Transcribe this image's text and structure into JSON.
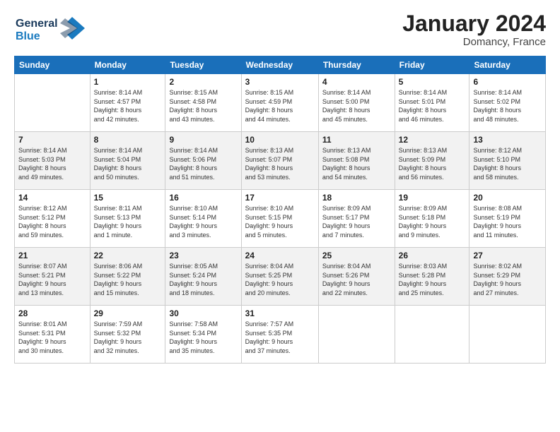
{
  "logo": {
    "line1": "General",
    "line2": "Blue"
  },
  "title": "January 2024",
  "subtitle": "Domancy, France",
  "headers": [
    "Sunday",
    "Monday",
    "Tuesday",
    "Wednesday",
    "Thursday",
    "Friday",
    "Saturday"
  ],
  "weeks": [
    [
      {
        "day": "",
        "info": ""
      },
      {
        "day": "1",
        "info": "Sunrise: 8:14 AM\nSunset: 4:57 PM\nDaylight: 8 hours\nand 42 minutes."
      },
      {
        "day": "2",
        "info": "Sunrise: 8:15 AM\nSunset: 4:58 PM\nDaylight: 8 hours\nand 43 minutes."
      },
      {
        "day": "3",
        "info": "Sunrise: 8:15 AM\nSunset: 4:59 PM\nDaylight: 8 hours\nand 44 minutes."
      },
      {
        "day": "4",
        "info": "Sunrise: 8:14 AM\nSunset: 5:00 PM\nDaylight: 8 hours\nand 45 minutes."
      },
      {
        "day": "5",
        "info": "Sunrise: 8:14 AM\nSunset: 5:01 PM\nDaylight: 8 hours\nand 46 minutes."
      },
      {
        "day": "6",
        "info": "Sunrise: 8:14 AM\nSunset: 5:02 PM\nDaylight: 8 hours\nand 48 minutes."
      }
    ],
    [
      {
        "day": "7",
        "info": "Sunrise: 8:14 AM\nSunset: 5:03 PM\nDaylight: 8 hours\nand 49 minutes."
      },
      {
        "day": "8",
        "info": "Sunrise: 8:14 AM\nSunset: 5:04 PM\nDaylight: 8 hours\nand 50 minutes."
      },
      {
        "day": "9",
        "info": "Sunrise: 8:14 AM\nSunset: 5:06 PM\nDaylight: 8 hours\nand 51 minutes."
      },
      {
        "day": "10",
        "info": "Sunrise: 8:13 AM\nSunset: 5:07 PM\nDaylight: 8 hours\nand 53 minutes."
      },
      {
        "day": "11",
        "info": "Sunrise: 8:13 AM\nSunset: 5:08 PM\nDaylight: 8 hours\nand 54 minutes."
      },
      {
        "day": "12",
        "info": "Sunrise: 8:13 AM\nSunset: 5:09 PM\nDaylight: 8 hours\nand 56 minutes."
      },
      {
        "day": "13",
        "info": "Sunrise: 8:12 AM\nSunset: 5:10 PM\nDaylight: 8 hours\nand 58 minutes."
      }
    ],
    [
      {
        "day": "14",
        "info": "Sunrise: 8:12 AM\nSunset: 5:12 PM\nDaylight: 8 hours\nand 59 minutes."
      },
      {
        "day": "15",
        "info": "Sunrise: 8:11 AM\nSunset: 5:13 PM\nDaylight: 9 hours\nand 1 minute."
      },
      {
        "day": "16",
        "info": "Sunrise: 8:10 AM\nSunset: 5:14 PM\nDaylight: 9 hours\nand 3 minutes."
      },
      {
        "day": "17",
        "info": "Sunrise: 8:10 AM\nSunset: 5:15 PM\nDaylight: 9 hours\nand 5 minutes."
      },
      {
        "day": "18",
        "info": "Sunrise: 8:09 AM\nSunset: 5:17 PM\nDaylight: 9 hours\nand 7 minutes."
      },
      {
        "day": "19",
        "info": "Sunrise: 8:09 AM\nSunset: 5:18 PM\nDaylight: 9 hours\nand 9 minutes."
      },
      {
        "day": "20",
        "info": "Sunrise: 8:08 AM\nSunset: 5:19 PM\nDaylight: 9 hours\nand 11 minutes."
      }
    ],
    [
      {
        "day": "21",
        "info": "Sunrise: 8:07 AM\nSunset: 5:21 PM\nDaylight: 9 hours\nand 13 minutes."
      },
      {
        "day": "22",
        "info": "Sunrise: 8:06 AM\nSunset: 5:22 PM\nDaylight: 9 hours\nand 15 minutes."
      },
      {
        "day": "23",
        "info": "Sunrise: 8:05 AM\nSunset: 5:24 PM\nDaylight: 9 hours\nand 18 minutes."
      },
      {
        "day": "24",
        "info": "Sunrise: 8:04 AM\nSunset: 5:25 PM\nDaylight: 9 hours\nand 20 minutes."
      },
      {
        "day": "25",
        "info": "Sunrise: 8:04 AM\nSunset: 5:26 PM\nDaylight: 9 hours\nand 22 minutes."
      },
      {
        "day": "26",
        "info": "Sunrise: 8:03 AM\nSunset: 5:28 PM\nDaylight: 9 hours\nand 25 minutes."
      },
      {
        "day": "27",
        "info": "Sunrise: 8:02 AM\nSunset: 5:29 PM\nDaylight: 9 hours\nand 27 minutes."
      }
    ],
    [
      {
        "day": "28",
        "info": "Sunrise: 8:01 AM\nSunset: 5:31 PM\nDaylight: 9 hours\nand 30 minutes."
      },
      {
        "day": "29",
        "info": "Sunrise: 7:59 AM\nSunset: 5:32 PM\nDaylight: 9 hours\nand 32 minutes."
      },
      {
        "day": "30",
        "info": "Sunrise: 7:58 AM\nSunset: 5:34 PM\nDaylight: 9 hours\nand 35 minutes."
      },
      {
        "day": "31",
        "info": "Sunrise: 7:57 AM\nSunset: 5:35 PM\nDaylight: 9 hours\nand 37 minutes."
      },
      {
        "day": "",
        "info": ""
      },
      {
        "day": "",
        "info": ""
      },
      {
        "day": "",
        "info": ""
      }
    ]
  ]
}
